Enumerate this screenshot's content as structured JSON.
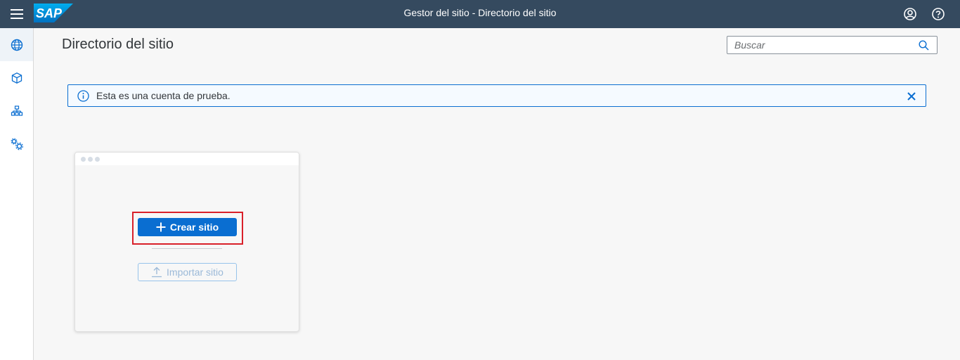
{
  "shell": {
    "title": "Gestor del sitio - Directorio del sitio",
    "logo_text": "SAP",
    "icons": [
      "menu-icon",
      "user-icon",
      "help-icon"
    ]
  },
  "sidenav": {
    "items": [
      {
        "icon": "globe-icon"
      },
      {
        "icon": "cube-icon"
      },
      {
        "icon": "hierarchy-icon"
      },
      {
        "icon": "settings-icon"
      }
    ]
  },
  "page": {
    "title": "Directorio del sitio"
  },
  "search": {
    "placeholder": "Buscar",
    "value": ""
  },
  "message": {
    "text": "Esta es una cuenta de prueba.",
    "type": "information"
  },
  "card": {
    "create_label": "Crear sitio",
    "import_label": "Importar sitio"
  },
  "colors": {
    "shell": "#354a5f",
    "accent": "#0a6ed1",
    "highlight": "#d9202a"
  }
}
